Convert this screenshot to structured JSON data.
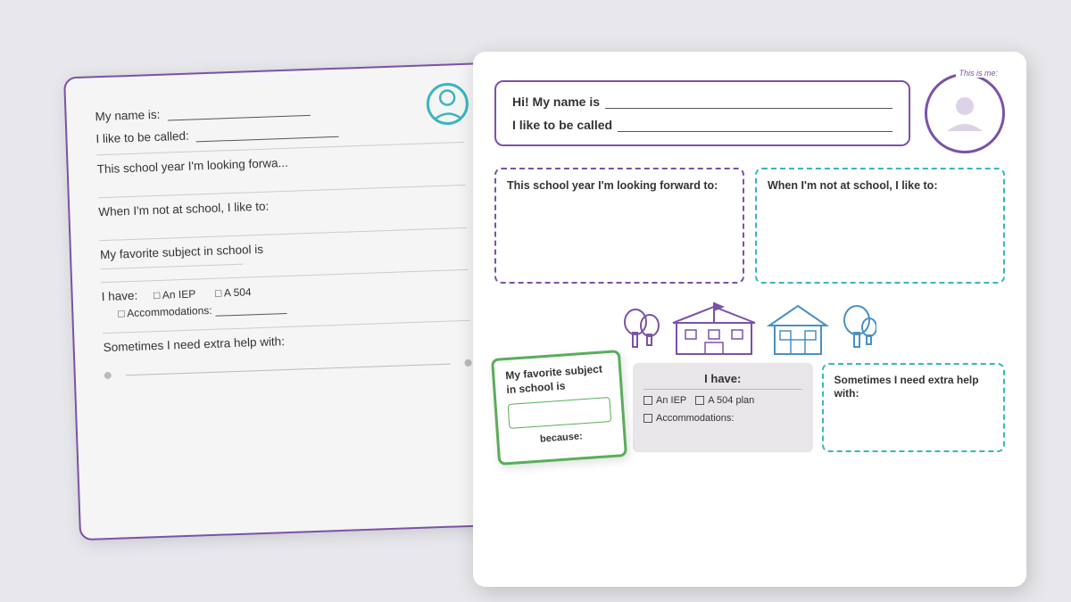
{
  "back_paper": {
    "fields": [
      {
        "label": "My name is:",
        "line_width": 160
      },
      {
        "label": "I like to be called:",
        "line_width": 140
      }
    ],
    "section1": {
      "label": "This school year I'm looking forward",
      "suffix": ""
    },
    "section2": {
      "label": "When I'm not at school, I like to:"
    },
    "section3": {
      "label": "My favorite subject in school is"
    },
    "section4": {
      "label": "I have:",
      "options": [
        "An IEP",
        "A 504",
        "Accommodations:"
      ]
    },
    "section5": {
      "label": "Sometimes I need extra help with:"
    }
  },
  "front_paper": {
    "header": {
      "name_label": "Hi! My name is",
      "called_label": "I like to be called",
      "photo_label": "This is me:"
    },
    "box1": {
      "title": "This school year I'm looking forward to:"
    },
    "box2": {
      "title": "When I'm not at school, I like to:"
    },
    "green_card": {
      "title": "My favorite subject in school is",
      "because_label": "because:"
    },
    "gray_box": {
      "title": "I have:",
      "options": [
        "An IEP",
        "A 504 plan",
        "Accommodations:"
      ]
    },
    "sometimes_box": {
      "title": "Sometimes I need extra help with:"
    }
  },
  "colors": {
    "purple": "#7b52a8",
    "teal": "#3ab5c0",
    "green": "#5aad5a",
    "blue": "#4a90c4",
    "bg": "#e8e8ec"
  }
}
